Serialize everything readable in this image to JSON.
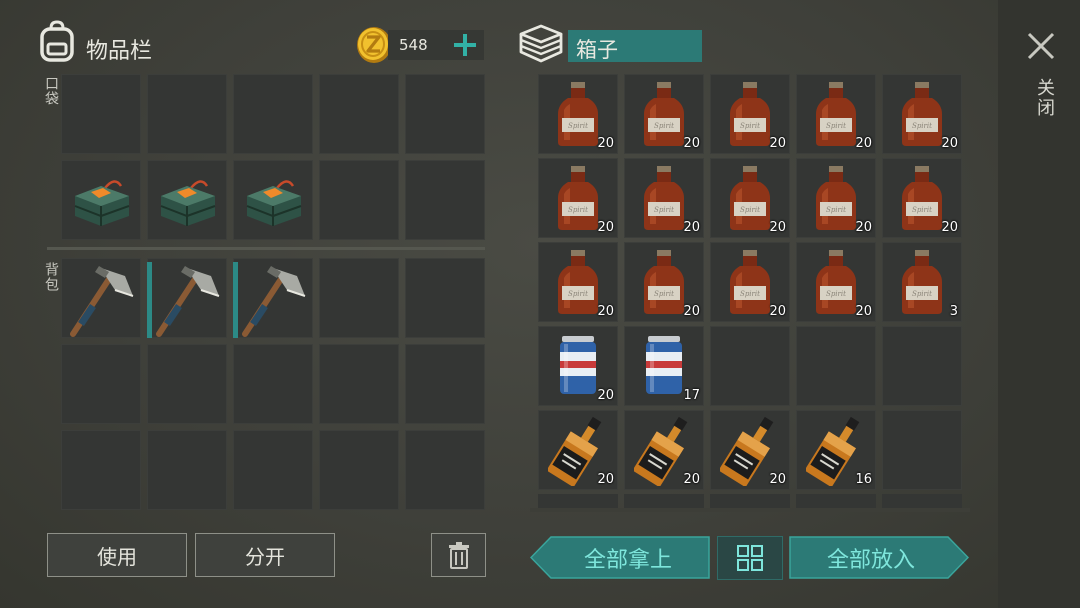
{
  "inventory": {
    "title": "物品栏",
    "coins": "548",
    "pocket_label": "口袋",
    "backpack_label": "背包",
    "pocket_slots": [
      {
        "item": "",
        "count": ""
      },
      {
        "item": "",
        "count": ""
      },
      {
        "item": "",
        "count": ""
      },
      {
        "item": "",
        "count": ""
      },
      {
        "item": "",
        "count": ""
      },
      {
        "item": "c4-explosive",
        "count": ""
      },
      {
        "item": "c4-explosive",
        "count": ""
      },
      {
        "item": "c4-explosive",
        "count": ""
      },
      {
        "item": "",
        "count": ""
      },
      {
        "item": "",
        "count": ""
      }
    ],
    "backpack_slots": [
      {
        "item": "hatchet",
        "count": ""
      },
      {
        "item": "hatchet",
        "count": ""
      },
      {
        "item": "hatchet",
        "count": ""
      },
      {
        "item": "",
        "count": ""
      },
      {
        "item": "",
        "count": ""
      },
      {
        "item": "",
        "count": ""
      },
      {
        "item": "",
        "count": ""
      },
      {
        "item": "",
        "count": ""
      },
      {
        "item": "",
        "count": ""
      },
      {
        "item": "",
        "count": ""
      },
      {
        "item": "",
        "count": ""
      },
      {
        "item": "",
        "count": ""
      },
      {
        "item": "",
        "count": ""
      },
      {
        "item": "",
        "count": ""
      },
      {
        "item": "",
        "count": ""
      }
    ],
    "use_button": "使用",
    "split_button": "分开"
  },
  "box": {
    "title": "箱子",
    "bottle_label": "Spirit",
    "slots": [
      {
        "item": "spirit-bottle",
        "count": "20"
      },
      {
        "item": "spirit-bottle",
        "count": "20"
      },
      {
        "item": "spirit-bottle",
        "count": "20"
      },
      {
        "item": "spirit-bottle",
        "count": "20"
      },
      {
        "item": "spirit-bottle",
        "count": "20"
      },
      {
        "item": "spirit-bottle",
        "count": "20"
      },
      {
        "item": "spirit-bottle",
        "count": "20"
      },
      {
        "item": "spirit-bottle",
        "count": "20"
      },
      {
        "item": "spirit-bottle",
        "count": "20"
      },
      {
        "item": "spirit-bottle",
        "count": "20"
      },
      {
        "item": "spirit-bottle",
        "count": "20"
      },
      {
        "item": "spirit-bottle",
        "count": "20"
      },
      {
        "item": "spirit-bottle",
        "count": "20"
      },
      {
        "item": "spirit-bottle",
        "count": "20"
      },
      {
        "item": "spirit-bottle",
        "count": "3"
      },
      {
        "item": "beer-can",
        "count": "20"
      },
      {
        "item": "beer-can",
        "count": "17"
      },
      {
        "item": "",
        "count": ""
      },
      {
        "item": "",
        "count": ""
      },
      {
        "item": "",
        "count": ""
      },
      {
        "item": "whiskey-bottle",
        "count": "20"
      },
      {
        "item": "whiskey-bottle",
        "count": "20"
      },
      {
        "item": "whiskey-bottle",
        "count": "20"
      },
      {
        "item": "whiskey-bottle",
        "count": "16"
      },
      {
        "item": "",
        "count": ""
      }
    ],
    "take_all_button": "全部拿上",
    "put_all_button": "全部放入"
  },
  "close_label": "关闭",
  "colors": {
    "teal": "#2c8a86",
    "teal_text": "#7ee6dc",
    "slot": "#343634",
    "coin": "#e6b020"
  }
}
